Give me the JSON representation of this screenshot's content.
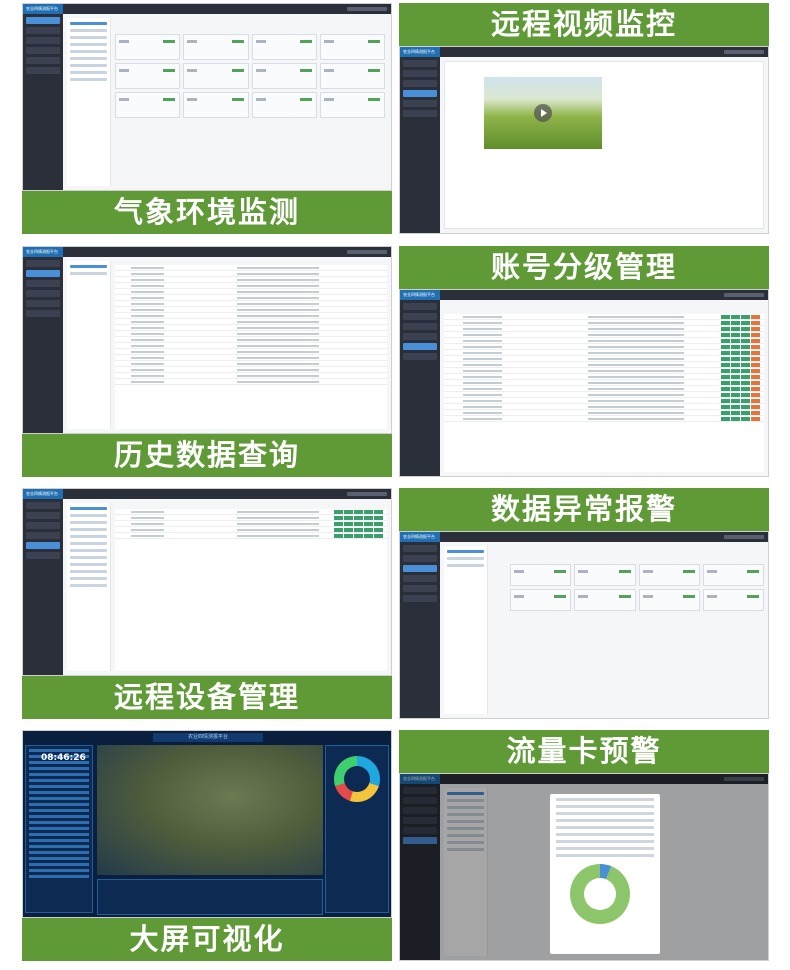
{
  "features": [
    {
      "label": "气象环境监测"
    },
    {
      "label": "远程视频监控"
    },
    {
      "label": "历史数据查询"
    },
    {
      "label": "账号分级管理"
    },
    {
      "label": "远程设备管理"
    },
    {
      "label": "数据异常报警"
    },
    {
      "label": "大屏可视化"
    },
    {
      "label": "流量卡预警"
    }
  ],
  "colors": {
    "banner": "#5f9a37",
    "sidebar": "#2b2f3a",
    "accent": "#4a90d9"
  },
  "bigscreen": {
    "title": "农业四情测报平台",
    "clock": "08:46:26"
  },
  "app_title": "农业四情测报平台"
}
